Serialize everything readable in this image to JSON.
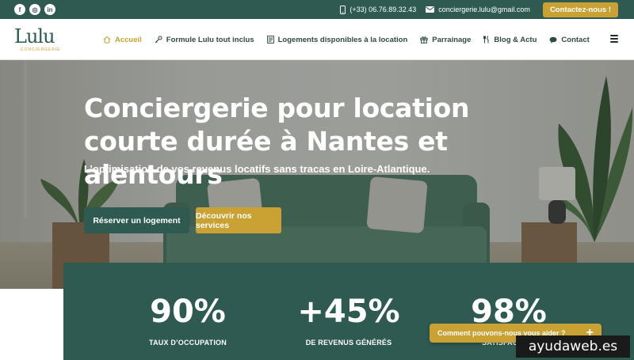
{
  "topbar": {
    "socials": [
      {
        "icon": "facebook-icon",
        "glyph": "f"
      },
      {
        "icon": "instagram-icon",
        "glyph": "◎"
      },
      {
        "icon": "linkedin-icon",
        "glyph": "in"
      }
    ],
    "phone": "(+33) 06.76.89.32.43",
    "email": "conciergerie.lulu@gmail.com",
    "cta_label": "Contactez-nous !"
  },
  "header": {
    "logo_word": "Lulu",
    "logo_sub": "CONCIERGERIE",
    "nav": [
      {
        "label": "Accueil",
        "icon": "home-icon",
        "active": true
      },
      {
        "label": "Formule Lulu tout inclus",
        "icon": "key-icon",
        "active": false
      },
      {
        "label": "Logements disponibles à la location",
        "icon": "list-icon",
        "active": false
      },
      {
        "label": "Parrainage",
        "icon": "gift-icon",
        "active": false
      },
      {
        "label": "Blog & Actu",
        "icon": "utensils-icon",
        "active": false
      },
      {
        "label": "Contact",
        "icon": "chat-icon",
        "active": false
      }
    ]
  },
  "hero": {
    "title": "Conciergerie pour location courte durée à Nantes et alentours",
    "subtitle": "L’optimisation de vos revenus locatifs sans tracas en Loire-Atlantique.",
    "primary_button": "Réserver un logement",
    "secondary_button": "Découvrir nos services"
  },
  "stats": [
    {
      "value": "90%",
      "label": "TAUX D’OCCUPATION"
    },
    {
      "value": "+45%",
      "label": "DE REVENUS GÉNÉRÉS"
    },
    {
      "value": "98%",
      "label": "SATISFACTION"
    }
  ],
  "chat": {
    "label": "Comment pouvons-nous vous aider ?",
    "plus": "+"
  },
  "watermark": "ayudaweb.es",
  "colors": {
    "brand": "#2f5a52",
    "accent": "#c9a233"
  }
}
